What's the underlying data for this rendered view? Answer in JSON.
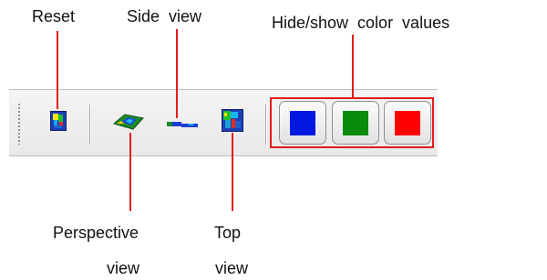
{
  "annotations": {
    "reset": "Reset",
    "side_view": "Side  view",
    "hide_show": "Hide/show  color  values",
    "perspective_line1": "Perspective",
    "perspective_line2": "view",
    "top_line1": "Top",
    "top_line2": "view"
  },
  "toolbar": {
    "tools": [
      {
        "name": "reset-view-icon"
      },
      {
        "name": "perspective-view-icon"
      },
      {
        "name": "side-view-icon"
      },
      {
        "name": "top-view-icon"
      }
    ],
    "color_toggles": [
      {
        "name": "blue",
        "color": "#0018e0"
      },
      {
        "name": "green",
        "color": "#0a8c0a"
      },
      {
        "name": "red",
        "color": "#ff0000"
      }
    ]
  },
  "colors": {
    "annotation_line": "#e51b1b",
    "toolbar_bg": "#eeeeee"
  }
}
